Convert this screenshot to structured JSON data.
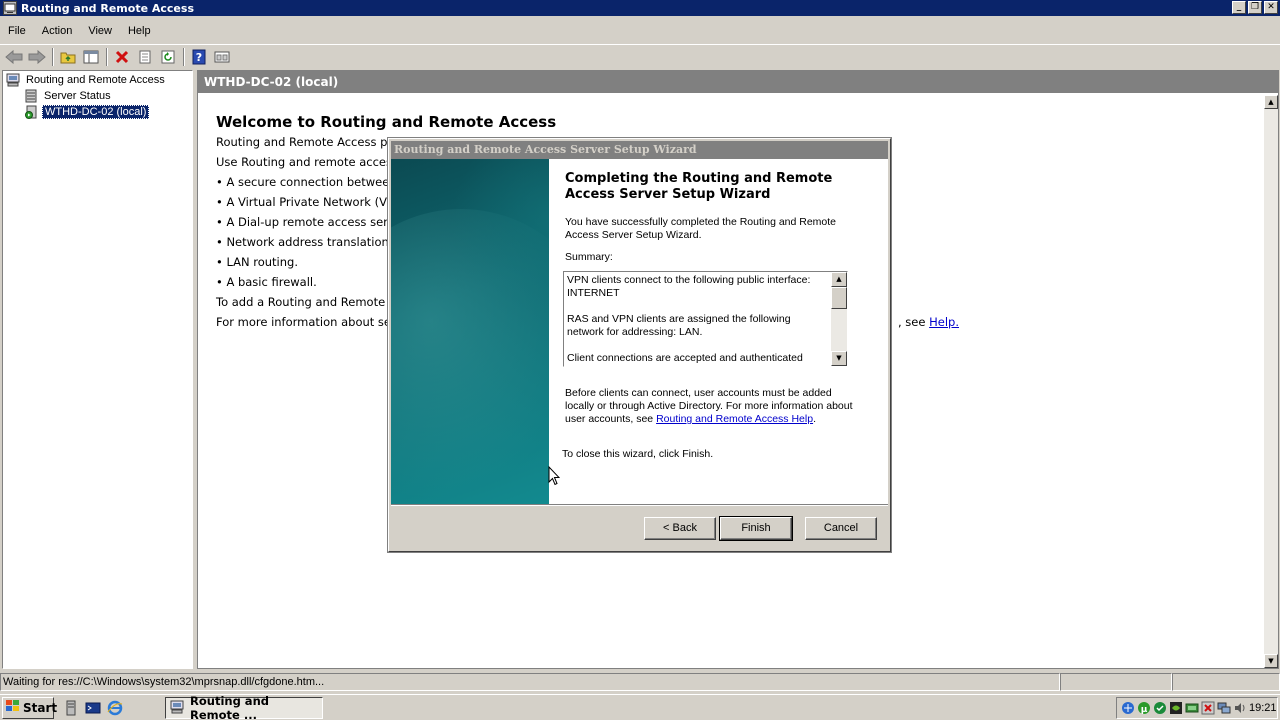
{
  "window": {
    "title": "Routing and Remote Access",
    "controls": [
      "minimize",
      "restore",
      "close"
    ]
  },
  "menu": [
    "File",
    "Action",
    "View",
    "Help"
  ],
  "toolbar": {
    "icons": [
      "back-icon",
      "forward-icon",
      "up-folder-icon",
      "show-hide-tree-icon",
      "delete-icon",
      "properties-icon",
      "refresh-icon",
      "help-icon",
      "console-view-icon"
    ]
  },
  "tree": {
    "root": "Routing and Remote Access",
    "children": [
      {
        "label": "Server Status"
      },
      {
        "label": "WTHD-DC-02 (local)",
        "selected": true
      }
    ]
  },
  "details": {
    "header": "WTHD-DC-02 (local)",
    "title": "Welcome to Routing and Remote Access",
    "lines": [
      "Routing and Remote Access p",
      "Use Routing and remote acces",
      "• A secure connection betweer",
      "• A Virtual Private Network (V",
      "• A Dial-up remote access ser",
      "• Network address translation",
      "• LAN routing.",
      "• A basic firewall.",
      "To add a Routing and Remote",
      "For more information about se"
    ],
    "help_prefix": ", see ",
    "help_link": "Help."
  },
  "wizard": {
    "title": "Routing and Remote Access Server Setup Wizard",
    "heading": "Completing the Routing and Remote Access Server Setup Wizard",
    "intro": "You have successfully completed the Routing and Remote Access Server Setup Wizard.",
    "summary_label": "Summary:",
    "summary": [
      "VPN clients connect to the following public interface: INTERNET",
      "RAS and VPN clients are assigned the following network for addressing: LAN.",
      "Client connections are accepted and authenticated"
    ],
    "note": "Before clients can connect, user accounts must be added locally or through Active Directory. For more information about user accounts, see ",
    "note_link": "Routing and Remote Access Help",
    "note_end": ".",
    "close_text": "To close this wizard, click Finish.",
    "buttons": {
      "back": "< Back",
      "finish": "Finish",
      "cancel": "Cancel"
    }
  },
  "statusbar": {
    "text": "Waiting for res://C:\\Windows\\system32\\mprsnap.dll/cfgdone.htm..."
  },
  "taskbar": {
    "start": "Start",
    "active_task": "Routing and Remote ...",
    "clock": "19:21"
  },
  "colors": {
    "title_active": "#0a246a",
    "pane_header": "#808080",
    "wizard_side": "#0f6a72",
    "link": "#0000cc"
  }
}
